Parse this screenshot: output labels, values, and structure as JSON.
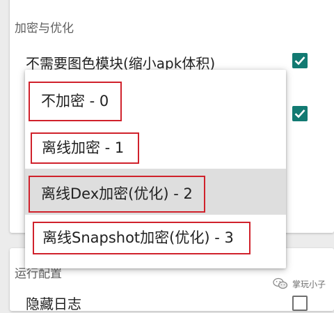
{
  "settings": {
    "section_encryption_title": "加密与优化",
    "row_no_color_module_label": "不需要图色模块(缩小apk体积)",
    "row_no_color_module_checked": true,
    "row_second_checked": true,
    "section_runtime_title": "运行配置",
    "row_hidden_label": "隐藏日志",
    "row_hidden_checked": false
  },
  "dropdown": {
    "options": [
      {
        "label": "不加密 - 0",
        "selected": false
      },
      {
        "label": "离线加密 - 1",
        "selected": false
      },
      {
        "label": "离线Dex加密(优化) - 2",
        "selected": true
      },
      {
        "label": "离线Snapshot加密(优化) - 3",
        "selected": false
      }
    ]
  },
  "watermark": {
    "text": "掌玩小子",
    "icon": "wechat-icon"
  },
  "colors": {
    "accent_checkbox": "#127a72",
    "highlight_box": "#d0212b",
    "selected_item_bg": "#dedede"
  }
}
